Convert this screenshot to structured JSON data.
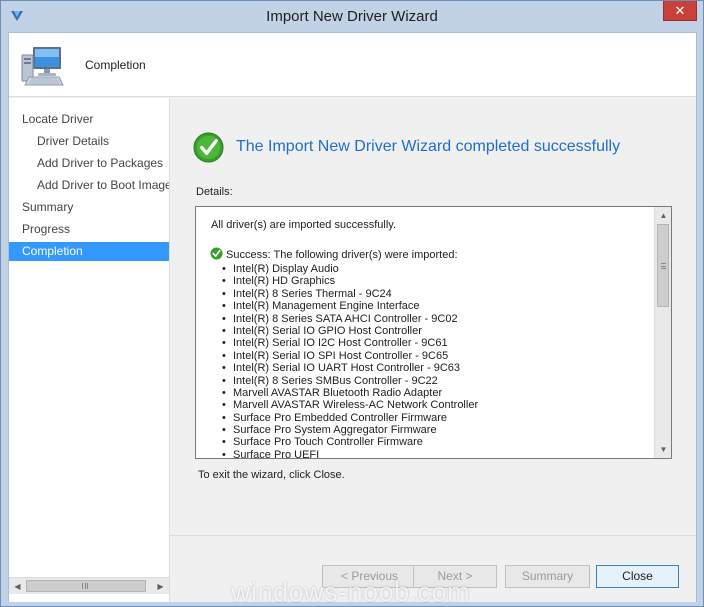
{
  "window": {
    "title": "Import New Driver Wizard",
    "close_glyph": "✕",
    "app_icon": "sccm-arrow-icon"
  },
  "header": {
    "title": "Completion",
    "icon": "computer-monitor-icon"
  },
  "nav": {
    "items": [
      {
        "label": "Locate Driver",
        "indent": 0,
        "active": false
      },
      {
        "label": "Driver Details",
        "indent": 1,
        "active": false
      },
      {
        "label": "Add Driver to Packages",
        "indent": 1,
        "active": false
      },
      {
        "label": "Add Driver to Boot Image",
        "indent": 1,
        "active": false
      },
      {
        "label": "Summary",
        "indent": 0,
        "active": false
      },
      {
        "label": "Progress",
        "indent": 0,
        "active": false
      },
      {
        "label": "Completion",
        "indent": 0,
        "active": true
      }
    ],
    "scroll_left_glyph": "◀",
    "scroll_right_glyph": "▶"
  },
  "main": {
    "success_title": "The Import New Driver Wizard completed successfully",
    "details_label": "Details:",
    "details": {
      "first_line": "All driver(s) are imported successfully.",
      "success_line": "Success: The following driver(s) were imported:",
      "drivers": [
        "Intel(R) Display Audio",
        "Intel(R) HD Graphics",
        "Intel(R) 8 Series Thermal - 9C24",
        "Intel(R) Management Engine Interface",
        "Intel(R) 8 Series SATA AHCI Controller - 9C02",
        "Intel(R) Serial IO GPIO Host Controller",
        "Intel(R) Serial IO I2C Host Controller - 9C61",
        "Intel(R) Serial IO SPI Host Controller - 9C65",
        "Intel(R) Serial IO UART Host Controller - 9C63",
        "Intel(R) 8 Series SMBus Controller - 9C22",
        "Marvell AVASTAR Bluetooth Radio Adapter",
        "Marvell AVASTAR Wireless-AC Network Controller",
        "Surface Pro Embedded Controller Firmware",
        "Surface Pro System Aggregator Firmware",
        "Surface Pro Touch Controller Firmware",
        "Surface Pro UEFI"
      ],
      "scroll_up_glyph": "▲",
      "scroll_down_glyph": "▼"
    },
    "exit_text": "To exit the wizard, click Close."
  },
  "buttons": {
    "previous": "< Previous",
    "next": "Next >",
    "summary": "Summary",
    "close": "Close"
  },
  "watermark": "windows-noob.com",
  "colors": {
    "accent": "#3399ff",
    "title_blue": "#1e6ec8",
    "frame": "#c2d2e6",
    "close_red": "#c7403a",
    "success_green": "#3a9e2c"
  }
}
